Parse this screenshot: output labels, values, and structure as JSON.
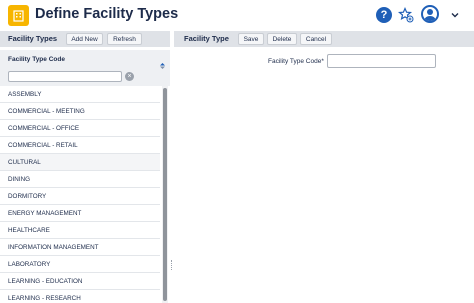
{
  "header": {
    "title": "Define Facility Types",
    "app_icon": "building-icon",
    "help_glyph": "?",
    "icons": [
      "help-icon",
      "favorite-star-icon",
      "user-avatar-icon",
      "chevron-down-icon"
    ]
  },
  "left_panel": {
    "title": "Facility Types",
    "add_label": "Add New",
    "refresh_label": "Refresh",
    "column_label": "Facility Type Code",
    "filter_value": "",
    "clear_glyph": "×",
    "rows": [
      "ASSEMBLY",
      "COMMERCIAL - MEETING",
      "COMMERCIAL - OFFICE",
      "COMMERCIAL - RETAIL",
      "CULTURAL",
      "DINING",
      "DORMITORY",
      "ENERGY MANAGEMENT",
      "HEALTHCARE",
      "INFORMATION MANAGEMENT",
      "LABORATORY",
      "LEARNING - EDUCATION",
      "LEARNING - RESEARCH"
    ]
  },
  "right_panel": {
    "title": "Facility Type",
    "save_label": "Save",
    "delete_label": "Delete",
    "cancel_label": "Cancel",
    "field_label": "Facility Type Code*",
    "field_value": ""
  },
  "colors": {
    "accent": "#1f5fb7",
    "app_icon_bg": "#f7b500",
    "bar_bg": "#dfe2e7"
  }
}
